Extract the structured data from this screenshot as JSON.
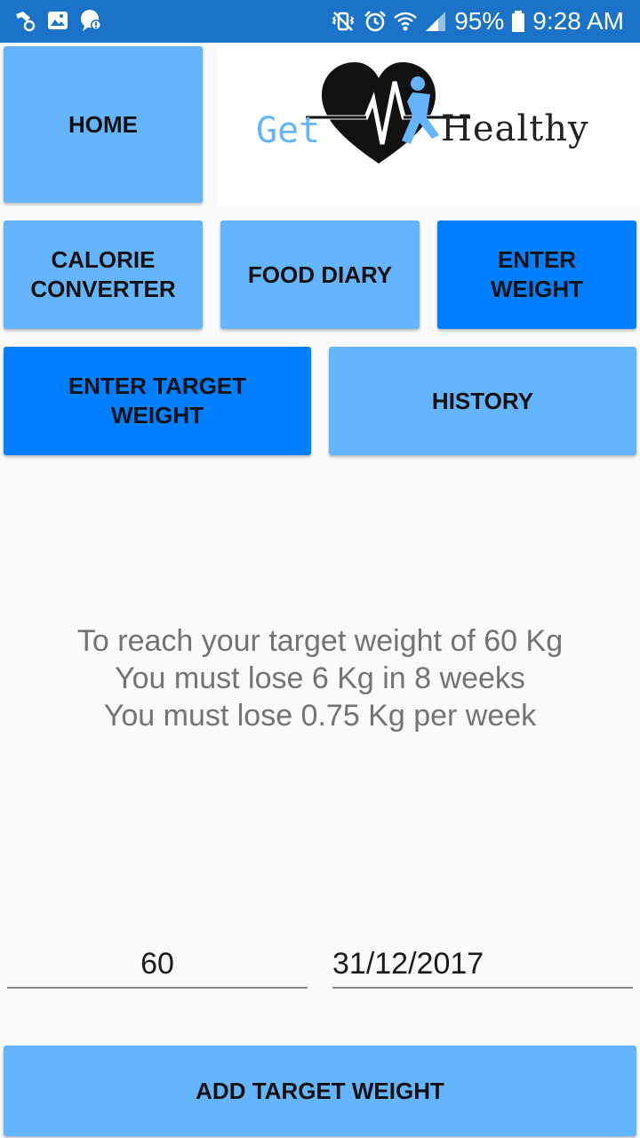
{
  "status_bar": {
    "battery": "95%",
    "time": "9:28 AM",
    "left_icons": [
      "notification-app-icon",
      "gallery-icon",
      "chat-icon"
    ],
    "right_icons": [
      "vibrate-mute-icon",
      "alarm-icon",
      "wifi-icon",
      "signal-icon",
      "battery-icon"
    ]
  },
  "nav": {
    "home": "HOME",
    "calorie_converter": "CALORIE CONVERTER",
    "food_diary": "FOOD DIARY",
    "enter_weight": "ENTER WEIGHT",
    "enter_target_weight": "ENTER TARGET WEIGHT",
    "history": "HISTORY"
  },
  "logo": {
    "get": "Get",
    "healthy": "Healthy"
  },
  "summary": {
    "line1": "To reach your target weight of 60 Kg",
    "line2": "You must lose 6 Kg in 8 weeks",
    "line3": "You must lose 0.75 Kg per week"
  },
  "form": {
    "target_weight_value": "60",
    "target_date_value": "31/12/2017",
    "submit_label": "ADD TARGET WEIGHT"
  },
  "colors": {
    "status_bar": "#1a73c9",
    "button_light": "#64b5fe",
    "button_active": "#0080ff",
    "summary_text": "#737373"
  }
}
